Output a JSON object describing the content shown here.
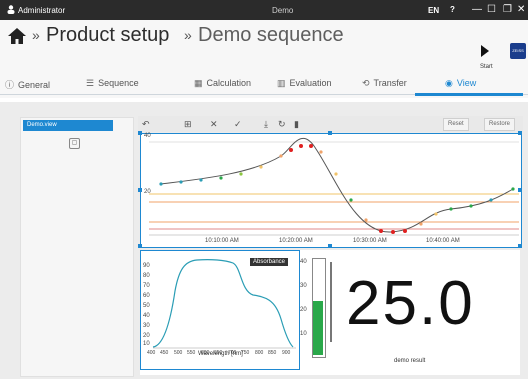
{
  "titlebar": {
    "user": "Administrator",
    "center": "Demo",
    "language": "EN",
    "help": "?"
  },
  "breadcrumb": {
    "level1": "Product setup",
    "level2": "Demo sequence",
    "separator": "»"
  },
  "run": {
    "label": "Start"
  },
  "tabs": [
    {
      "label": "General",
      "icon": "info-icon"
    },
    {
      "label": "Sequence",
      "icon": "sequence-icon"
    },
    {
      "label": "Calculation",
      "icon": "calculator-icon"
    },
    {
      "label": "Evaluation",
      "icon": "chart-icon"
    },
    {
      "label": "Transfer",
      "icon": "transfer-icon"
    },
    {
      "label": "View",
      "icon": "eye-icon"
    }
  ],
  "left": {
    "selected": "Demo.view"
  },
  "toolbar": {
    "reset_label": "Reset",
    "restore_label": "Restore"
  },
  "timechart": {
    "y_ticks": [
      "40",
      "20"
    ],
    "x_ticks": [
      "10:10:00 AM",
      "10:20:00 AM",
      "10:30:00 AM",
      "10:40:00 AM"
    ]
  },
  "absorbance": {
    "title": "Absorbance",
    "xlabel": "Wavelength [nm]",
    "y_ticks": [
      "90",
      "80",
      "70",
      "60",
      "50",
      "40",
      "30",
      "20",
      "10"
    ],
    "x_ticks": [
      "400",
      "450",
      "500",
      "550",
      "600",
      "650",
      "700",
      "750",
      "800",
      "850",
      "900"
    ]
  },
  "bargauge": {
    "ticks": [
      "40",
      "30",
      "20",
      "10"
    ],
    "level": 0.56,
    "color": "#2aa84a"
  },
  "result": {
    "value": "25.0",
    "label": "demo result"
  },
  "colors": {
    "accent": "#1e88d1",
    "titlebar": "#2b2b2b"
  }
}
